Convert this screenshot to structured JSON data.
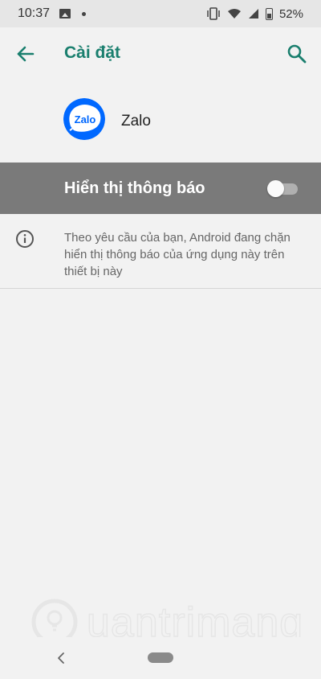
{
  "status_bar": {
    "time": "10:37",
    "battery": "52%",
    "icons": [
      "image-icon",
      "dot-icon",
      "vibrate-icon",
      "wifi-icon",
      "signal-icon",
      "battery-icon"
    ]
  },
  "app_bar": {
    "title": "Cài đặt",
    "back_icon": "arrow-left-icon",
    "search_icon": "search-icon"
  },
  "app": {
    "name": "Zalo",
    "logo_text": "Zalo"
  },
  "notification_toggle": {
    "label": "Hiển thị thông báo",
    "enabled": false
  },
  "info": {
    "text": "Theo yêu cầu của bạn, Android đang chặn hiển thị thông báo của ứng dụng này trên thiết bị này"
  },
  "watermark": {
    "text": "uantrimang"
  },
  "colors": {
    "accent": "#1a7f6e",
    "toggle_row_bg": "#7a7a7a",
    "page_bg": "#f2f2f2",
    "zalo_blue": "#0068ff"
  }
}
